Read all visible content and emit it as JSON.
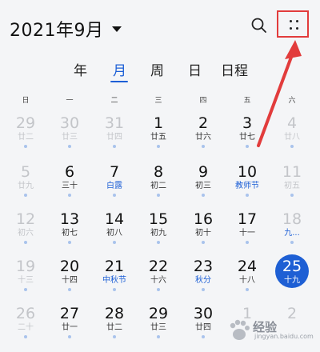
{
  "header": {
    "month_title": "2021年9月",
    "search_icon": "search-icon",
    "more_icon": "four-dot-grid-icon",
    "highlight_color": "#e23c3c"
  },
  "tabs": [
    {
      "label": "年",
      "active": false
    },
    {
      "label": "月",
      "active": true
    },
    {
      "label": "周",
      "active": false
    },
    {
      "label": "日",
      "active": false
    },
    {
      "label": "日程",
      "active": false
    }
  ],
  "weekdays": [
    "日",
    "一",
    "二",
    "三",
    "四",
    "五",
    "六"
  ],
  "weeks": [
    [
      {
        "day": "29",
        "lunar": "廿二",
        "other": true,
        "dot": true
      },
      {
        "day": "30",
        "lunar": "廿三",
        "other": true,
        "dot": true
      },
      {
        "day": "31",
        "lunar": "廿四",
        "other": true,
        "dot": true
      },
      {
        "day": "1",
        "lunar": "廿五",
        "dot": true
      },
      {
        "day": "2",
        "lunar": "廿六",
        "dot": true
      },
      {
        "day": "3",
        "lunar": "廿七",
        "dot": true
      },
      {
        "day": "4",
        "lunar": "廿八",
        "other": true,
        "dot": true
      }
    ],
    [
      {
        "day": "5",
        "lunar": "廿九",
        "other": true,
        "dot": true
      },
      {
        "day": "6",
        "lunar": "三十",
        "dot": true
      },
      {
        "day": "7",
        "lunar": "白露",
        "festival": true,
        "dot": true
      },
      {
        "day": "8",
        "lunar": "初二",
        "dot": true
      },
      {
        "day": "9",
        "lunar": "初三",
        "dot": true
      },
      {
        "day": "10",
        "lunar": "教师节",
        "festival": true,
        "dot": true
      },
      {
        "day": "11",
        "lunar": "初五",
        "other": true,
        "dot": true
      }
    ],
    [
      {
        "day": "12",
        "lunar": "初六",
        "other": true,
        "dot": true
      },
      {
        "day": "13",
        "lunar": "初七",
        "dot": true
      },
      {
        "day": "14",
        "lunar": "初八",
        "dot": true
      },
      {
        "day": "15",
        "lunar": "初九",
        "dot": true
      },
      {
        "day": "16",
        "lunar": "初十",
        "dot": true
      },
      {
        "day": "17",
        "lunar": "十一",
        "dot": true
      },
      {
        "day": "18",
        "lunar": "九...",
        "other": true,
        "festival": true,
        "dot": true
      }
    ],
    [
      {
        "day": "19",
        "lunar": "十三",
        "other": true,
        "dot": true
      },
      {
        "day": "20",
        "lunar": "十四",
        "dot": true
      },
      {
        "day": "21",
        "lunar": "中秋节",
        "festival": true,
        "dot": true
      },
      {
        "day": "22",
        "lunar": "十六",
        "dot": true
      },
      {
        "day": "23",
        "lunar": "秋分",
        "festival": true,
        "dot": true
      },
      {
        "day": "24",
        "lunar": "十八",
        "dot": true
      },
      {
        "day": "25",
        "lunar": "十九",
        "today": true,
        "dot": false
      }
    ],
    [
      {
        "day": "26",
        "lunar": "二十",
        "other": true,
        "dot": true
      },
      {
        "day": "27",
        "lunar": "廿一",
        "dot": true
      },
      {
        "day": "28",
        "lunar": "廿二",
        "dot": true
      },
      {
        "day": "29",
        "lunar": "廿三",
        "dot": true
      },
      {
        "day": "30",
        "lunar": "廿四",
        "dot": true
      },
      {
        "day": "1",
        "lunar": "",
        "other": true,
        "dot": false
      },
      {
        "day": "2",
        "lunar": "",
        "other": true,
        "dot": false
      }
    ]
  ],
  "colors": {
    "accent": "#1d5fd6",
    "today": "#1e5fd4",
    "event_dot": "#a9c3ec",
    "annotation": "#e23c3c"
  },
  "watermark": {
    "text": "经验",
    "sub": "jingyan.baidu.com"
  }
}
